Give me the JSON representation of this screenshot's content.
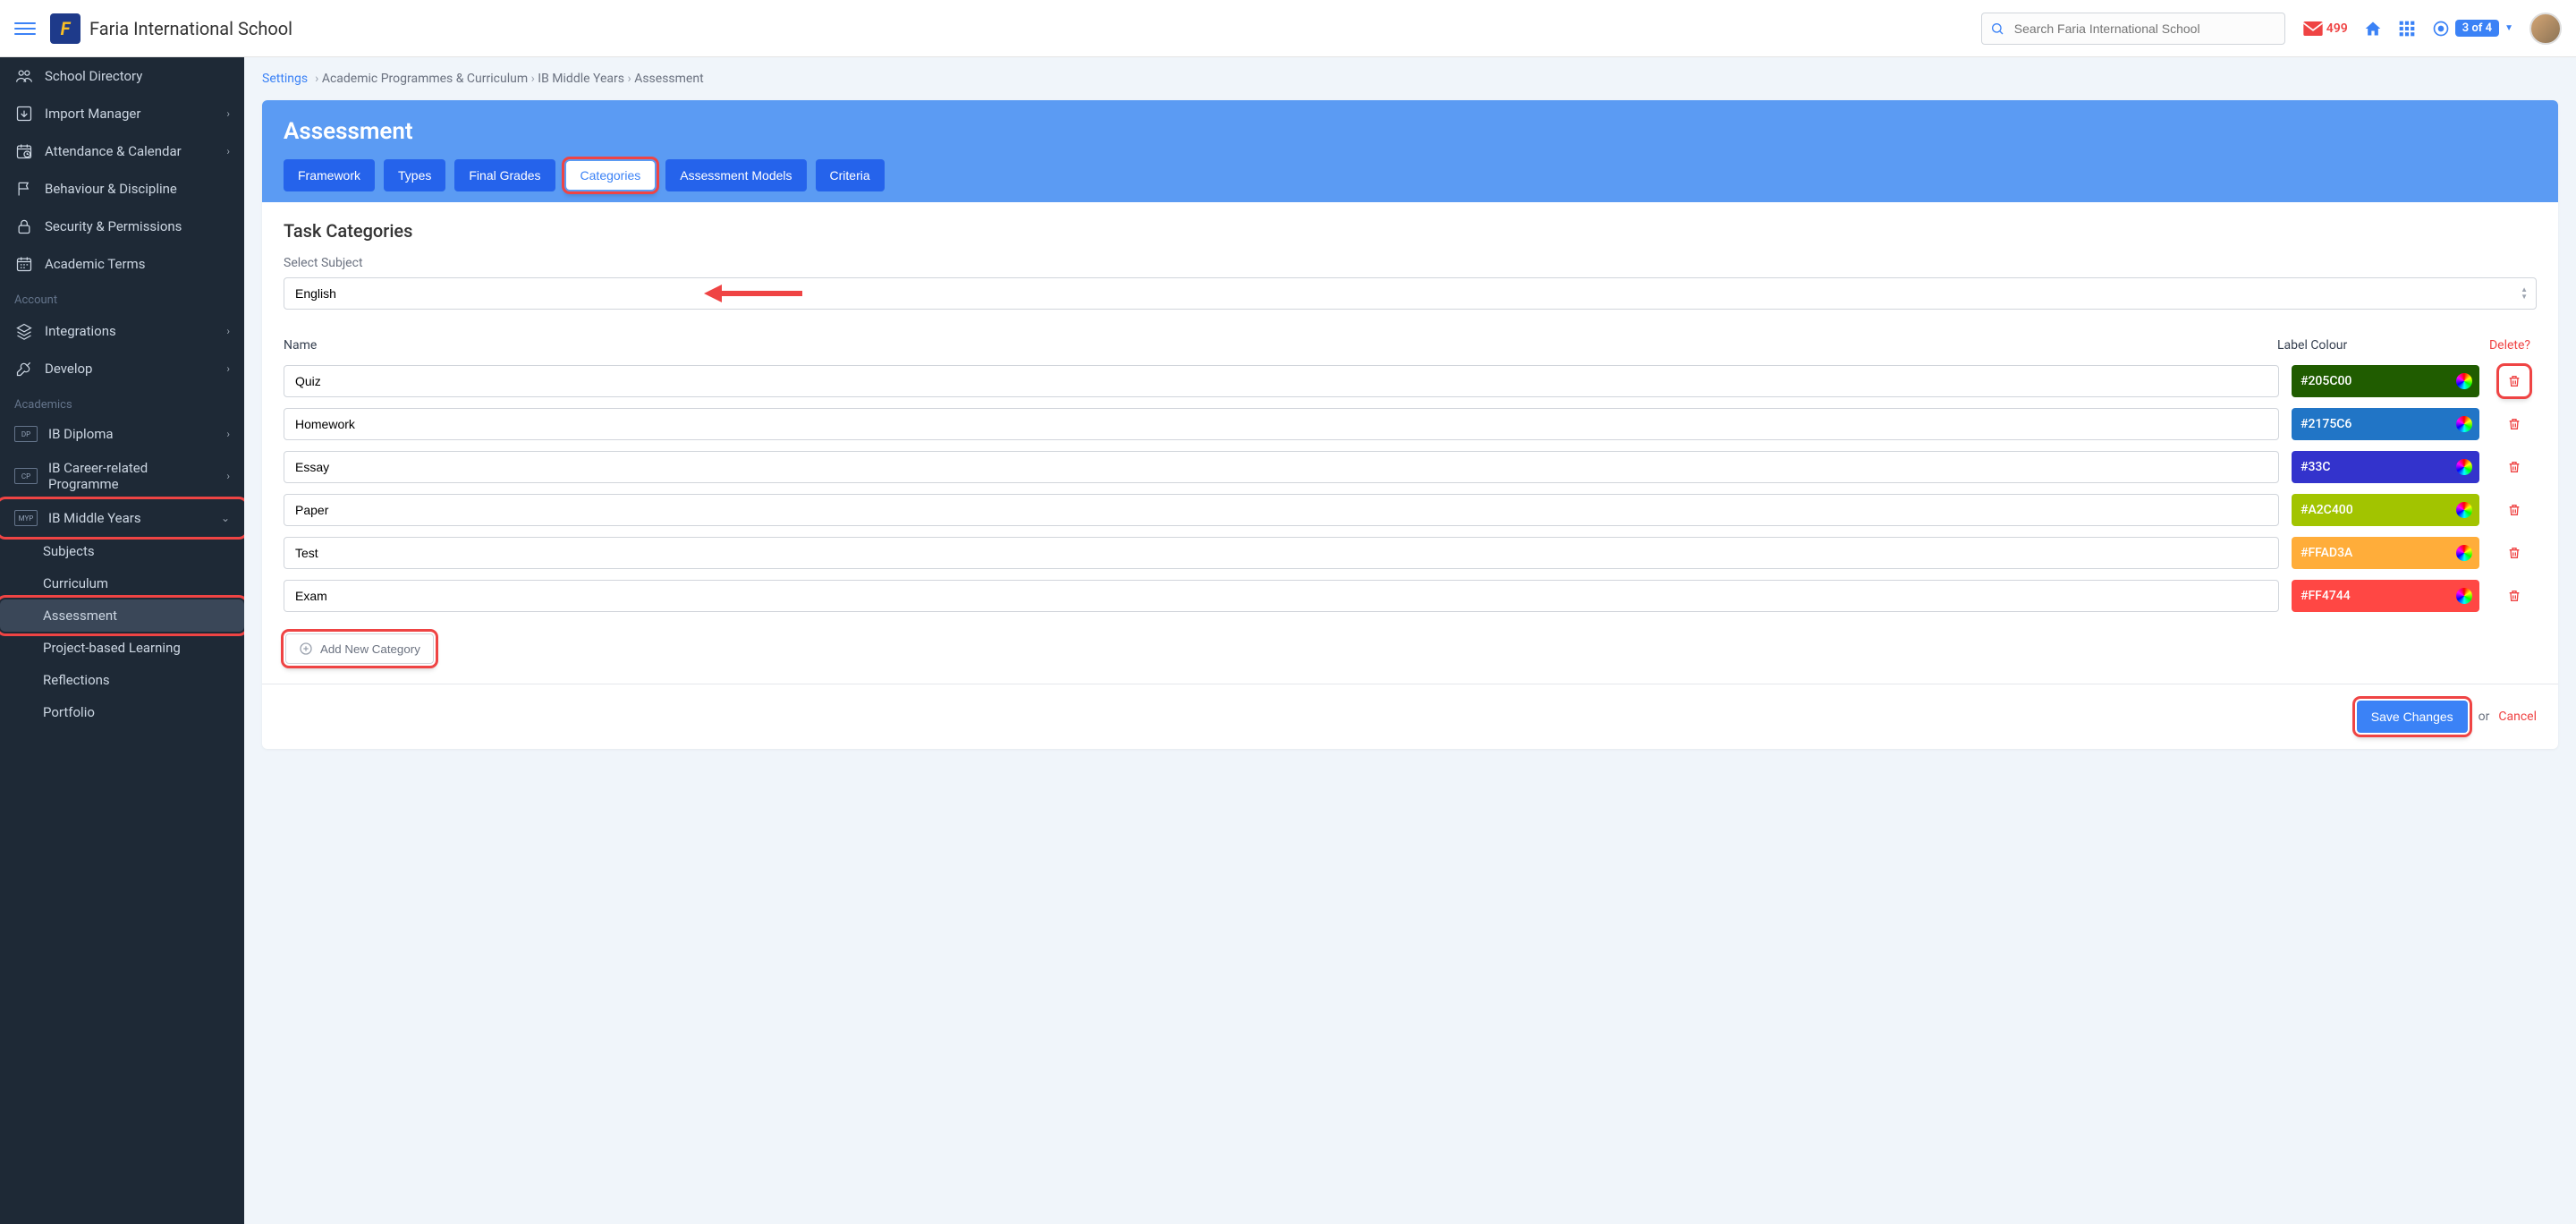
{
  "header": {
    "school_name": "Faria International School",
    "search_placeholder": "Search Faria International School",
    "mail_count": "499",
    "counter": "3 of 4"
  },
  "sidebar": {
    "top": [
      {
        "label": "School Directory",
        "icon": "users"
      },
      {
        "label": "Import Manager",
        "icon": "import",
        "chev": true
      },
      {
        "label": "Attendance & Calendar",
        "icon": "calendar-clock",
        "chev": true
      },
      {
        "label": "Behaviour & Discipline",
        "icon": "flag"
      },
      {
        "label": "Security & Permissions",
        "icon": "lock"
      },
      {
        "label": "Academic Terms",
        "icon": "calendar"
      }
    ],
    "account_label": "Account",
    "account": [
      {
        "label": "Integrations",
        "icon": "layers",
        "chev": true
      },
      {
        "label": "Develop",
        "icon": "wrench",
        "chev": true
      }
    ],
    "academics_label": "Academics",
    "academics": [
      {
        "label": "IB Diploma",
        "badge": "DP",
        "chev": true
      },
      {
        "label": "IB Career-related Programme",
        "badge": "CP",
        "chev": true
      },
      {
        "label": "IB Middle Years",
        "badge": "MYP",
        "chevdown": true,
        "hl": true
      }
    ],
    "subs": [
      {
        "label": "Subjects"
      },
      {
        "label": "Curriculum"
      },
      {
        "label": "Assessment",
        "active": true,
        "hl": true
      },
      {
        "label": "Project-based Learning"
      },
      {
        "label": "Reflections"
      },
      {
        "label": "Portfolio"
      }
    ]
  },
  "breadcrumb": {
    "root": "Settings",
    "items": [
      "Academic Programmes & Curriculum",
      "IB Middle Years",
      "Assessment"
    ]
  },
  "panel": {
    "title": "Assessment",
    "tabs": [
      "Framework",
      "Types",
      "Final Grades",
      "Categories",
      "Assessment Models",
      "Criteria"
    ],
    "active_tab": "Categories",
    "section_title": "Task Categories",
    "select_label": "Select Subject",
    "selected_subject": "English",
    "columns": {
      "name": "Name",
      "color": "Label Colour",
      "delete": "Delete?"
    },
    "categories": [
      {
        "name": "Quiz",
        "color": "#205C00",
        "hl_del": true
      },
      {
        "name": "Homework",
        "color": "#2175C6"
      },
      {
        "name": "Essay",
        "color": "#33C",
        "bg": "#3333CC"
      },
      {
        "name": "Paper",
        "color": "#A2C400"
      },
      {
        "name": "Test",
        "color": "#FFAD3A"
      },
      {
        "name": "Exam",
        "color": "#FF4744"
      }
    ],
    "add_label": "Add New Category",
    "save_label": "Save Changes",
    "or_label": "or",
    "cancel_label": "Cancel"
  }
}
